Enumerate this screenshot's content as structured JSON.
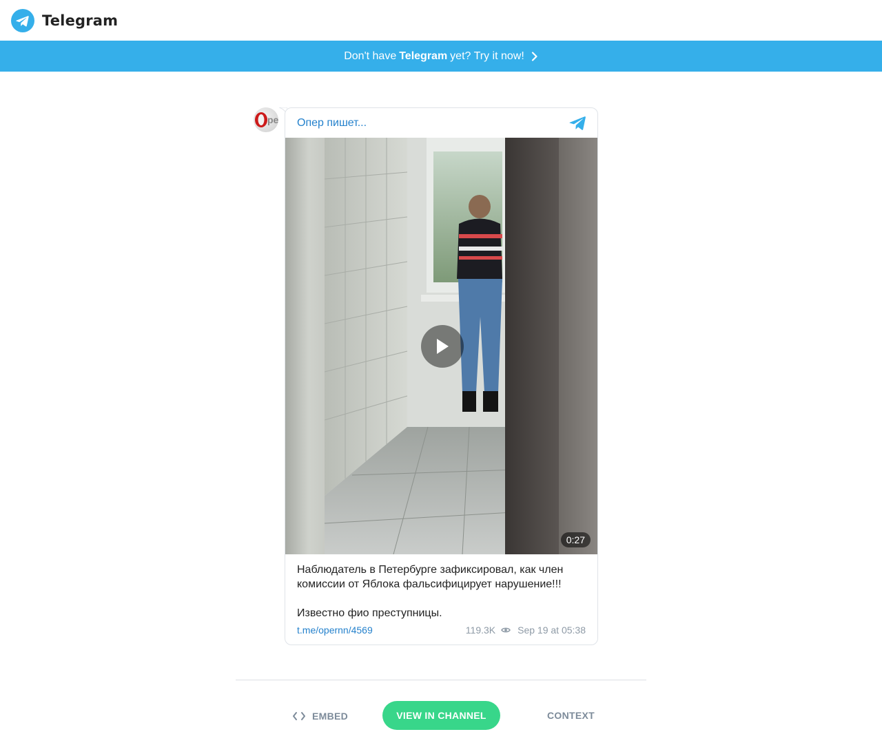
{
  "header": {
    "brand": "Telegram"
  },
  "banner": {
    "prefix": "Don't have",
    "brand": "Telegram",
    "suffix": "yet? Try it now!"
  },
  "post": {
    "channel_name": "Опер пишет...",
    "avatar_text": "Opep",
    "video_duration": "0:27",
    "text": "Наблюдатель в Петербурге зафиксировал, как член\nкомиссии от Яблока фальсифицирует нарушение!!!\n\nИзвестно фио преступницы.",
    "link": "t.me/opernn/4569",
    "views": "119.3K",
    "date": "Sep 19 at 05:38"
  },
  "actions": {
    "embed": "EMBED",
    "view_in_channel": "VIEW IN CHANNEL",
    "context": "CONTEXT"
  },
  "colors": {
    "brand_blue": "#35afea",
    "link_blue": "#2481cc",
    "green": "#38d68a",
    "muted": "#8e9aa6"
  }
}
